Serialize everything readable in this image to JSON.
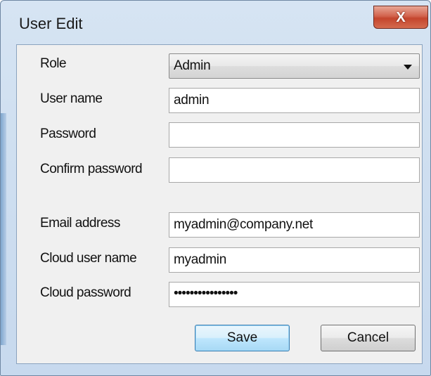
{
  "window": {
    "title": "User Edit",
    "close_glyph": "X"
  },
  "form": {
    "role": {
      "label": "Role",
      "value": "Admin"
    },
    "user_name": {
      "label": "User name",
      "value": "admin"
    },
    "password": {
      "label": "Password",
      "value": ""
    },
    "confirm_password": {
      "label": "Confirm password",
      "value": ""
    },
    "email": {
      "label": "Email address",
      "value": "myadmin@company.net"
    },
    "cloud_user_name": {
      "label": "Cloud user name",
      "value": "myadmin"
    },
    "cloud_password": {
      "label": "Cloud password",
      "value": "••••••••••••••••"
    }
  },
  "buttons": {
    "save": "Save",
    "cancel": "Cancel"
  }
}
